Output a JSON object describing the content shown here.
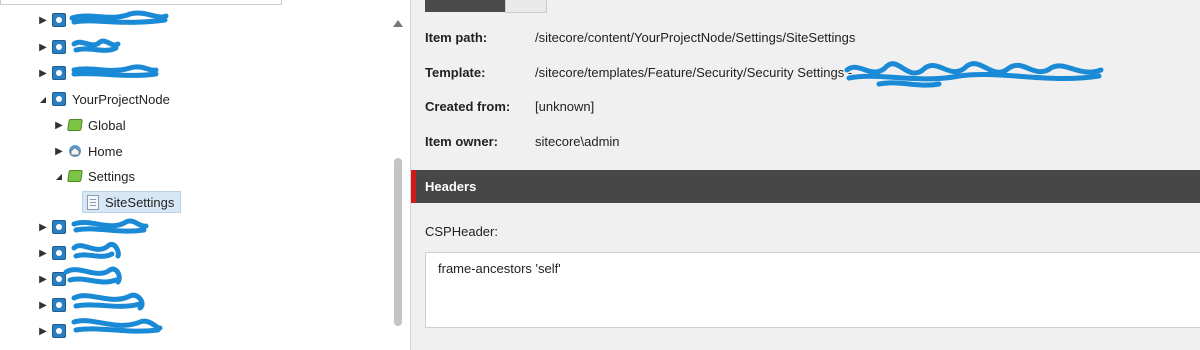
{
  "tree": {
    "items": [
      {
        "label": "",
        "level": 0,
        "icon": "database-icon",
        "toggle": "▶"
      },
      {
        "label": "",
        "level": 0,
        "icon": "database-icon",
        "toggle": "▶"
      },
      {
        "label": "",
        "level": 0,
        "icon": "database-icon",
        "toggle": "▶"
      },
      {
        "label": "YourProjectNode",
        "level": 0,
        "icon": "database-icon",
        "toggle": "◢"
      },
      {
        "label": "Global",
        "level": 1,
        "icon": "folder-icon",
        "toggle": "▶"
      },
      {
        "label": "Home",
        "level": 1,
        "icon": "home-icon",
        "toggle": "▶"
      },
      {
        "label": "Settings",
        "level": 1,
        "icon": "folder-icon",
        "toggle": "◢"
      },
      {
        "label": "SiteSettings",
        "level": 2,
        "icon": "document-icon",
        "toggle": ""
      },
      {
        "label": "",
        "level": 0,
        "icon": "database-icon",
        "toggle": "▶"
      },
      {
        "label": "",
        "level": 0,
        "icon": "database-icon",
        "toggle": "▶"
      },
      {
        "label": "",
        "level": 0,
        "icon": "database-icon",
        "toggle": "▶"
      },
      {
        "label": "",
        "level": 0,
        "icon": "database-icon",
        "toggle": "▶"
      },
      {
        "label": "",
        "level": 0,
        "icon": "database-icon",
        "toggle": "▶"
      }
    ]
  },
  "info": {
    "item_path_key": "Item path:",
    "item_path_val": "/sitecore/content/YourProjectNode/Settings/SiteSettings",
    "template_key": "Template:",
    "template_val": "/sitecore/templates/Feature/Security/Security Settings - ",
    "created_from_key": "Created from:",
    "created_from_val": "[unknown]",
    "owner_key": "Item owner:",
    "owner_val": "sitecore\\admin"
  },
  "section": {
    "title": "Headers"
  },
  "fields": {
    "csp_label": "CSPHeader:",
    "csp_value": "frame-ancestors 'self'"
  },
  "colors": {
    "accent": "#d01a1a",
    "section_bar": "#474747",
    "selected_bg": "#d8e7f5",
    "redaction": "#1a8ad6"
  }
}
